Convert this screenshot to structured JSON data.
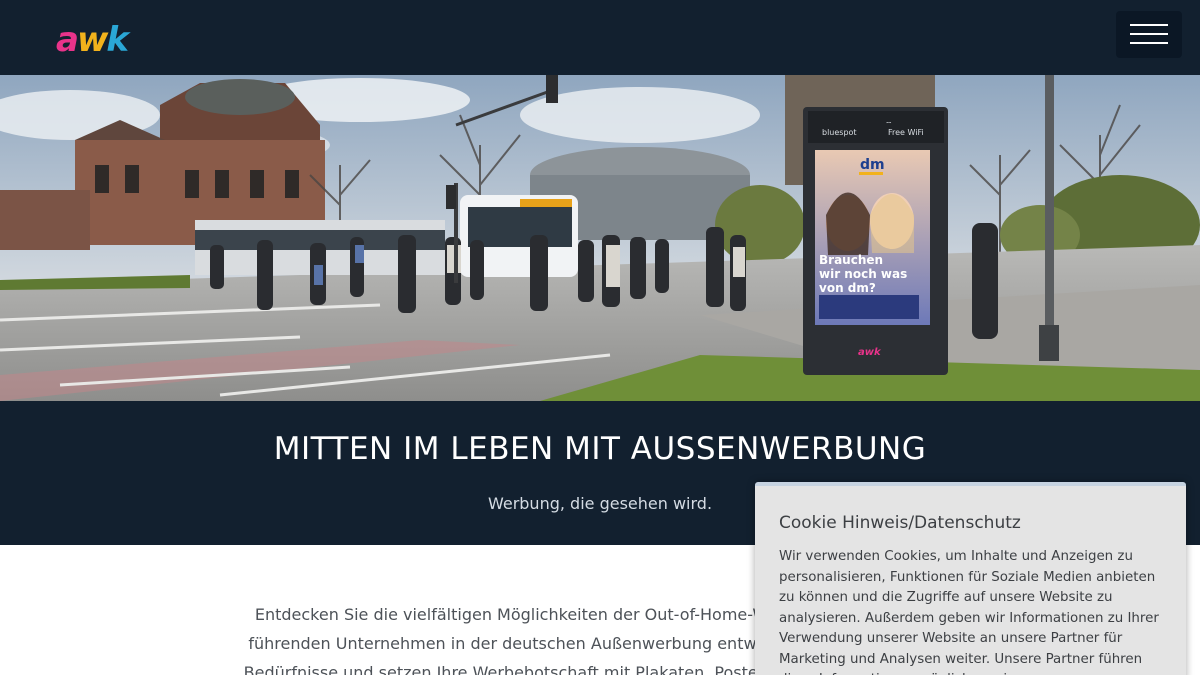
{
  "header": {
    "logo_letters": [
      {
        "char": "a",
        "color": "#e8338a"
      },
      {
        "char": "w",
        "color": "#f2b21c"
      },
      {
        "char": "k",
        "color": "#2aa7d6"
      }
    ],
    "menu_icon": "hamburger-menu-icon"
  },
  "hero": {
    "kiosk": {
      "brand": "bluespot",
      "wifi_label": "Free WiFi",
      "ad_brand": "dm",
      "ad_headline": [
        "Brauchen",
        "wir noch was",
        "von dm?"
      ],
      "screen_logo": "awk"
    }
  },
  "band": {
    "title": "MITTEN IM LEBEN MIT AUSSENWERBUNG",
    "subtitle": "Werbung, die gesehen wird."
  },
  "intro": {
    "lines": [
      "Entdecken Sie die vielfältigen Möglichkeiten der Out-of-Home-Werbung und lernen Sie",
      "führenden Unternehmen in der deutschen Außenwerbung entwickeln wir gemeinsam m",
      "Bedürfnisse und setzen Ihre Werbebotschaft mit Plakaten, Postern und Screens in Szene."
    ]
  },
  "cookie": {
    "title": "Cookie Hinweis/Datenschutz",
    "text": "Wir verwenden Cookies, um Inhalte und Anzeigen zu personalisieren, Funktionen für Soziale Medien anbieten zu können und die Zugriffe auf unsere Website zu analysieren. Außerdem geben wir Informationen zu Ihrer Verwendung unserer Website an unsere Partner für Marketing und Analysen weiter. Unsere Partner führen diese Informationen möglicherweise"
  }
}
